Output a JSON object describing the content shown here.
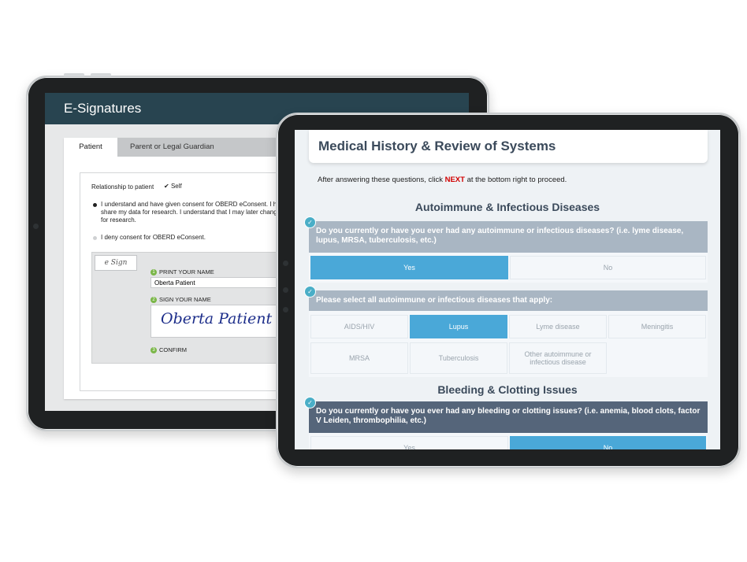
{
  "esign": {
    "title": "E-Signatures",
    "tabs": [
      "Patient",
      "Parent or Legal Guardian"
    ],
    "relationship_label": "Relationship to patient",
    "relationship_value": "Self",
    "consent_text_1": "I understand and have given consent for OBERD eConsent. I hav",
    "consent_text_2": "share my data for research. I understand that I may later change",
    "consent_text_3": "for research.",
    "deny_text": "I deny consent for OBERD eConsent.",
    "logo_text": "e Sign",
    "step1_label": "PRINT YOUR NAME",
    "step2_label": "SIGN YOUR NAME",
    "step3_label": "CONFIRM",
    "name_value": "Oberta Patient",
    "signature": "Oberta Patient"
  },
  "medical": {
    "title": "Medical History & Review of Systems",
    "instr_before": "After answering these questions, click ",
    "instr_next": "NEXT",
    "instr_after": " at the bottom right to proceed.",
    "section1": "Autoimmune & Infectious Diseases",
    "q1": "Do you currently or have you ever had any autoimmune or infectious diseases? (i.e. lyme disease, lupus, MRSA, tuberculosis, etc.)",
    "q1_options": [
      "Yes",
      "No"
    ],
    "q2": "Please select all autoimmune or infectious diseases that apply:",
    "q2_options": [
      "AIDS/HIV",
      "Lupus",
      "Lyme disease",
      "Meningitis",
      "MRSA",
      "Tuberculosis",
      "Other autoimmune or infectious disease"
    ],
    "section2": "Bleeding & Clotting Issues",
    "q3": "Do you currently or have you ever had any bleeding or clotting issues? (i.e. anemia, blood clots, factor V Leiden, thrombophilia, etc.)",
    "q3_options": [
      "Yes",
      "No"
    ]
  },
  "colors": {
    "header_dark": "#284450",
    "accent_blue": "#4aa8d8",
    "question_gray": "#a9b6c3",
    "question_dark": "#55657a"
  }
}
